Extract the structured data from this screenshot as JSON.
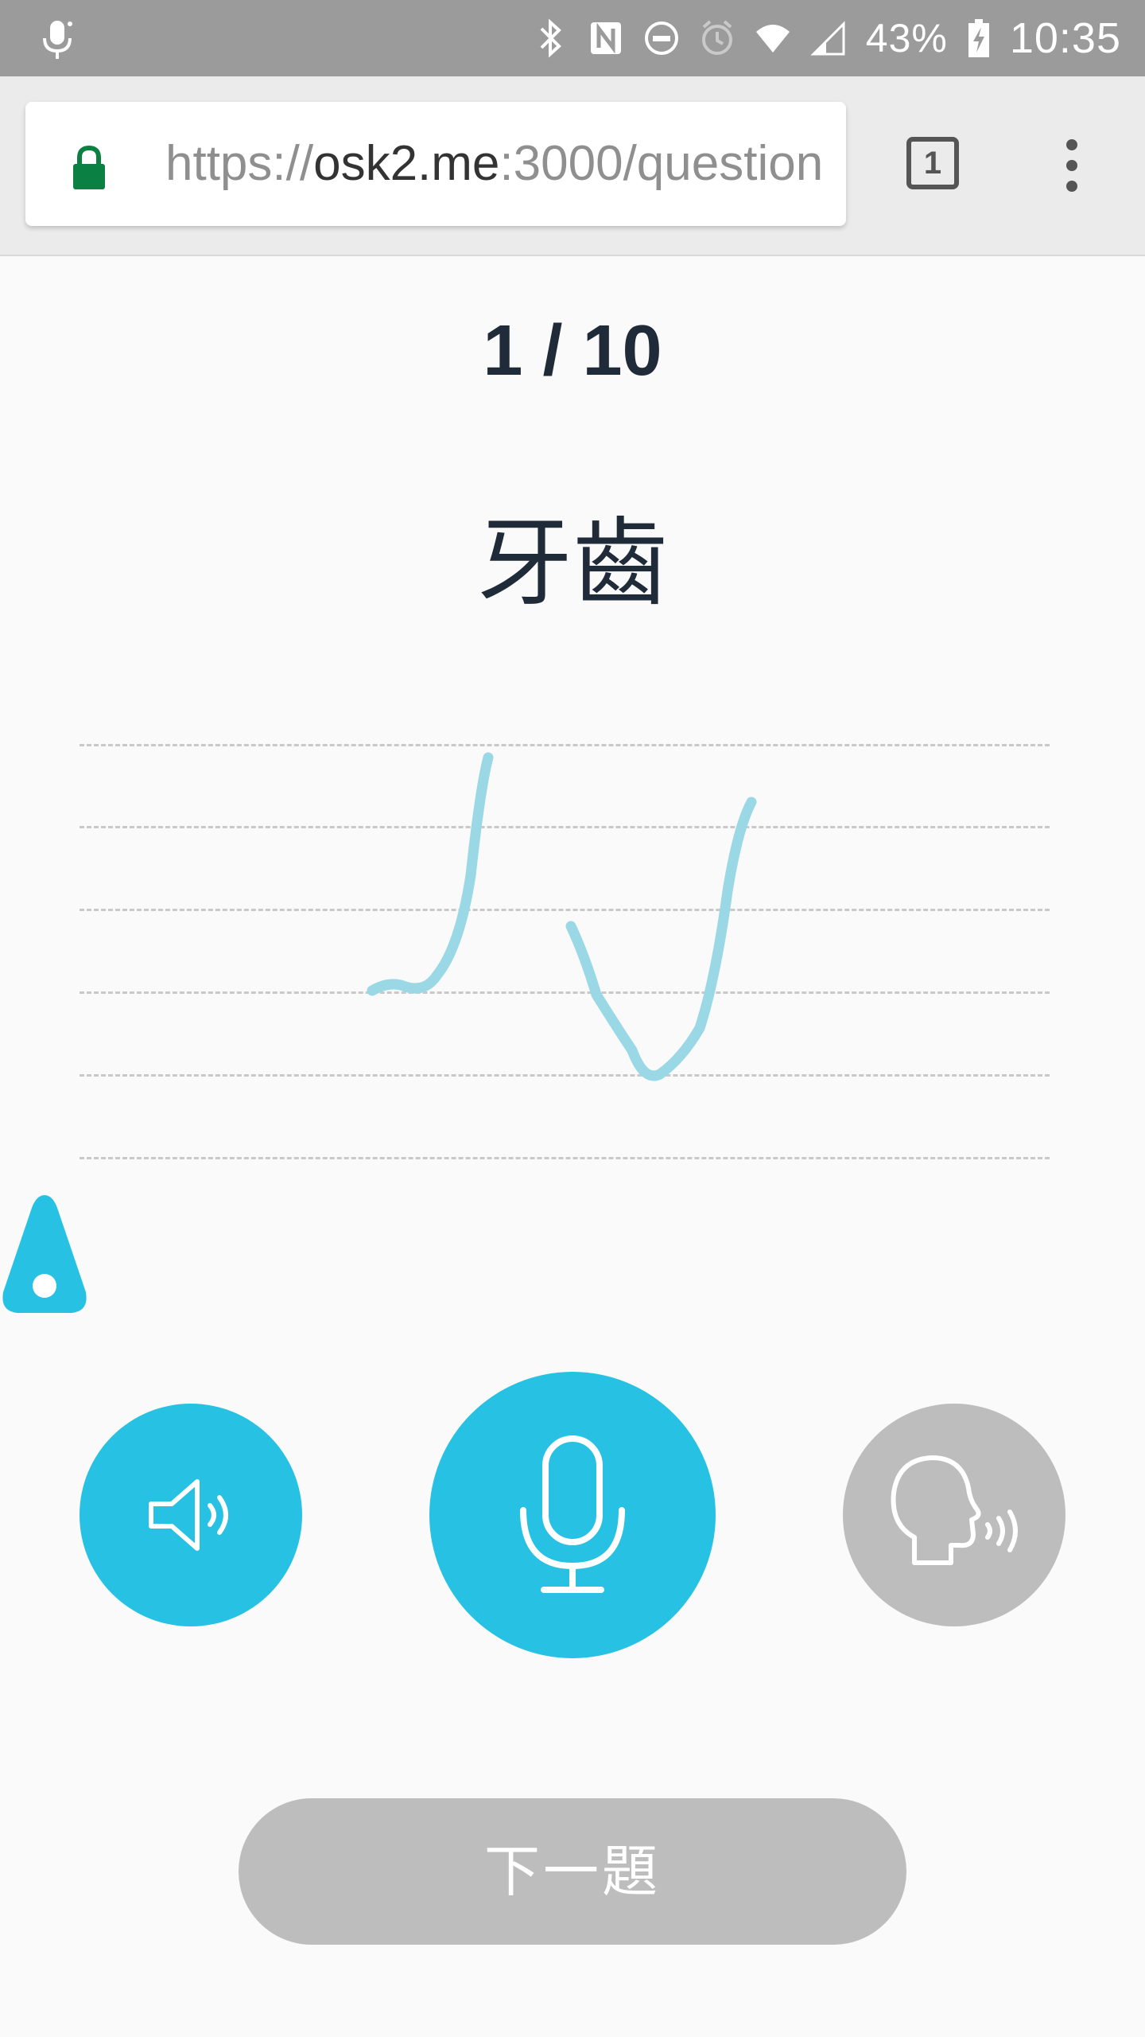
{
  "status_bar": {
    "battery_percent": "43%",
    "time": "10:35",
    "icons": [
      "mic-icon",
      "bluetooth-icon",
      "nfc-icon",
      "do-not-disturb-icon",
      "alarm-icon",
      "wifi-icon",
      "signal-icon",
      "battery-charging-icon"
    ]
  },
  "browser": {
    "url_scheme": "https://",
    "url_host": "osk2.me",
    "url_rest": ":3000/question",
    "tab_count": "1"
  },
  "quiz": {
    "progress": "1 / 10",
    "word": "牙齒"
  },
  "buttons": {
    "play_audio_icon": "speaker-icon",
    "record_icon": "microphone-icon",
    "speak_icon": "speaking-head-icon",
    "next_label": "下一題"
  },
  "colors": {
    "accent": "#26c1e3",
    "disabled": "#bdbdbd",
    "handwriting": "#9ad8e6",
    "text_dark": "#1f2b38",
    "lock_green": "#0b8043"
  }
}
